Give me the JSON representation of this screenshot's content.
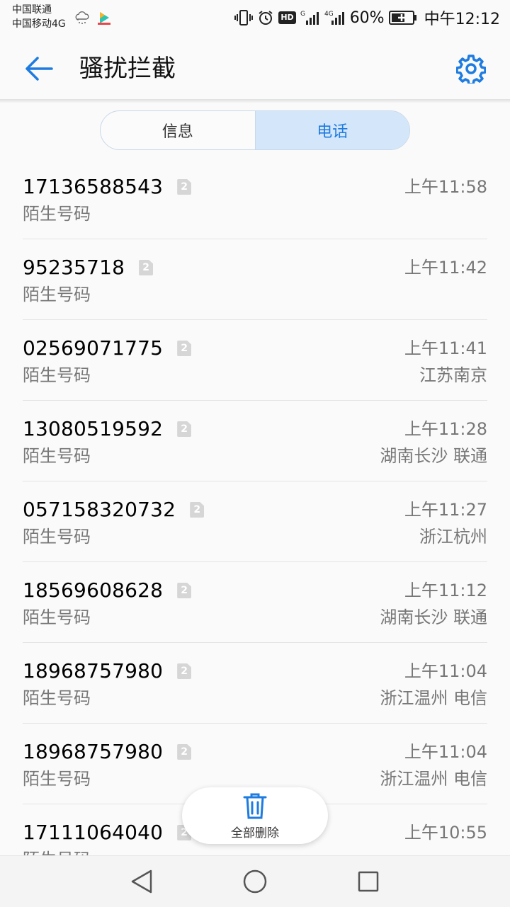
{
  "status_bar": {
    "carrier_1": "中国联通",
    "carrier_2": "中国移动4G",
    "hd": "HD",
    "battery": "60%",
    "time": "中午12:12"
  },
  "header": {
    "title": "骚扰拦截"
  },
  "tabs": [
    {
      "label": "信息",
      "active": false
    },
    {
      "label": "电话",
      "active": true
    }
  ],
  "calls": [
    {
      "number": "17136588543",
      "count": "2",
      "label": "陌生号码",
      "time": "上午11:58",
      "location": ""
    },
    {
      "number": "95235718",
      "count": "2",
      "label": "陌生号码",
      "time": "上午11:42",
      "location": ""
    },
    {
      "number": "02569071775",
      "count": "2",
      "label": "陌生号码",
      "time": "上午11:41",
      "location": "江苏南京"
    },
    {
      "number": "13080519592",
      "count": "2",
      "label": "陌生号码",
      "time": "上午11:28",
      "location": "湖南长沙 联通"
    },
    {
      "number": "057158320732",
      "count": "2",
      "label": "陌生号码",
      "time": "上午11:27",
      "location": "浙江杭州"
    },
    {
      "number": "18569608628",
      "count": "2",
      "label": "陌生号码",
      "time": "上午11:12",
      "location": "湖南长沙 联通"
    },
    {
      "number": "18968757980",
      "count": "2",
      "label": "陌生号码",
      "time": "上午11:04",
      "location": "浙江温州 电信"
    },
    {
      "number": "18968757980",
      "count": "2",
      "label": "陌生号码",
      "time": "上午11:04",
      "location": "浙江温州 电信"
    },
    {
      "number": "17111064040",
      "count": "2",
      "label": "陌生号码",
      "time": "上午10:55",
      "location": ""
    }
  ],
  "delete_all": {
    "label": "全部删除"
  },
  "colors": {
    "accent": "#1e7be0",
    "tab_active_bg": "#d4e6f9"
  }
}
